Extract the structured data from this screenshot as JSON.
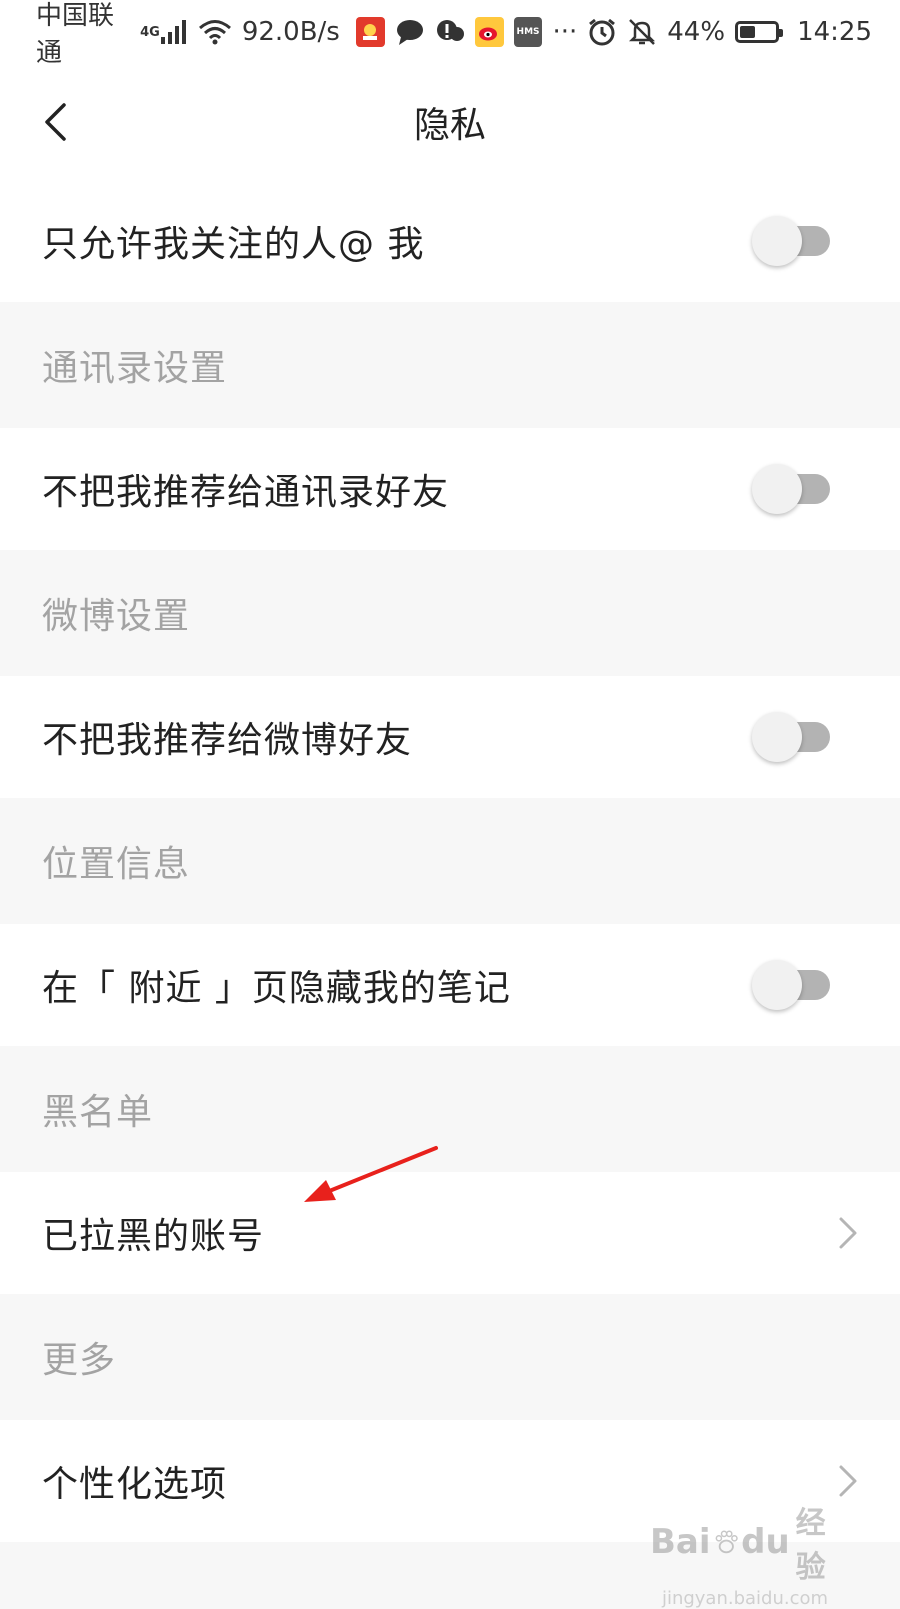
{
  "status_bar": {
    "carrier": "中国联通",
    "network": "4G",
    "speed": "92.0B/s",
    "more": "···",
    "battery_percent": "44%",
    "battery_level": 0.44,
    "time": "14:25",
    "hms_label": "HMS",
    "icons": [
      "signal-icon",
      "wifi-icon",
      "app-icon",
      "message-icon",
      "cloud-alert-icon",
      "weibo-icon",
      "hms-icon",
      "alarm-icon",
      "mute-icon",
      "battery-icon"
    ]
  },
  "nav": {
    "title": "隐私",
    "back_icon": "chevron-left-icon"
  },
  "sections": {
    "mention": {
      "label": "只允许我关注的人@ 我",
      "enabled": false
    },
    "contacts_header": "通讯录设置",
    "contacts": {
      "label": "不把我推荐给通讯录好友",
      "enabled": false
    },
    "weibo_header": "微博设置",
    "weibo": {
      "label": "不把我推荐给微博好友",
      "enabled": false
    },
    "location_header": "位置信息",
    "nearby": {
      "label": "在「 附近 」页隐藏我的笔记",
      "enabled": false
    },
    "blacklist_header": "黑名单",
    "blocked": {
      "label": "已拉黑的账号"
    },
    "more_header": "更多",
    "personalization": {
      "label": "个性化选项"
    }
  },
  "watermark": {
    "brand": "Bai",
    "brand2": "du",
    "suffix": "经验",
    "url": "jingyan.baidu.com"
  },
  "colors": {
    "annotation_arrow": "#e8211c",
    "toggle_off_track": "#b3b3b3",
    "section_header_text": "#a3a3a3"
  }
}
